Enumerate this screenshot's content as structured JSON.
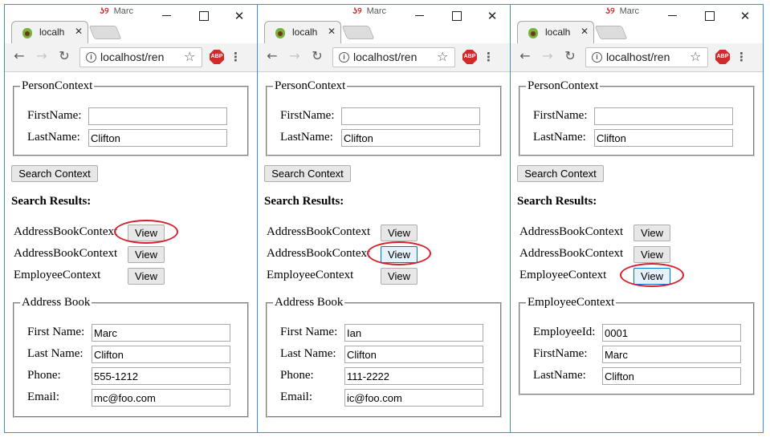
{
  "windows": [
    {
      "profile": "Marc",
      "tab_title": "localh",
      "url": "localhost/ren",
      "person_context": {
        "legend": "PersonContext",
        "first_name_label": "FirstName:",
        "first_name_value": "",
        "last_name_label": "LastName:",
        "last_name_value": "Clifton"
      },
      "search_button": "Search Context",
      "results_heading": "Search Results:",
      "results": [
        {
          "label": "AddressBookContext",
          "button": "View",
          "circled": true
        },
        {
          "label": "AddressBookContext",
          "button": "View",
          "circled": false
        },
        {
          "label": "EmployeeContext",
          "button": "View",
          "circled": false
        }
      ],
      "detail": {
        "legend": "Address Book",
        "fields": [
          {
            "label": "First Name:",
            "value": "Marc"
          },
          {
            "label": "Last Name:",
            "value": "Clifton"
          },
          {
            "label": "Phone:",
            "value": "555-1212"
          },
          {
            "label": "Email:",
            "value": "mc@foo.com"
          }
        ]
      }
    },
    {
      "profile": "Marc",
      "tab_title": "localh",
      "url": "localhost/ren",
      "person_context": {
        "legend": "PersonContext",
        "first_name_label": "FirstName:",
        "first_name_value": "",
        "last_name_label": "LastName:",
        "last_name_value": "Clifton"
      },
      "search_button": "Search Context",
      "results_heading": "Search Results:",
      "results": [
        {
          "label": "AddressBookContext",
          "button": "View",
          "circled": false
        },
        {
          "label": "AddressBookContext",
          "button": "View",
          "circled": true
        },
        {
          "label": "EmployeeContext",
          "button": "View",
          "circled": false
        }
      ],
      "detail": {
        "legend": "Address Book",
        "fields": [
          {
            "label": "First Name:",
            "value": "Ian"
          },
          {
            "label": "Last Name:",
            "value": "Clifton"
          },
          {
            "label": "Phone:",
            "value": "111-2222"
          },
          {
            "label": "Email:",
            "value": "ic@foo.com"
          }
        ]
      }
    },
    {
      "profile": "Marc",
      "tab_title": "localh",
      "url": "localhost/ren",
      "person_context": {
        "legend": "PersonContext",
        "first_name_label": "FirstName:",
        "first_name_value": "",
        "last_name_label": "LastName:",
        "last_name_value": "Clifton"
      },
      "search_button": "Search Context",
      "results_heading": "Search Results:",
      "results": [
        {
          "label": "AddressBookContext",
          "button": "View",
          "circled": false
        },
        {
          "label": "AddressBookContext",
          "button": "View",
          "circled": false
        },
        {
          "label": "EmployeeContext",
          "button": "View",
          "circled": true
        }
      ],
      "detail": {
        "legend": "EmployeeContext",
        "fields": [
          {
            "label": "EmployeeId:",
            "value": "0001"
          },
          {
            "label": "FirstName:",
            "value": "Marc"
          },
          {
            "label": "LastName:",
            "value": "Clifton"
          }
        ]
      }
    }
  ],
  "icons": {
    "profile": "profile-icon",
    "back": "back-arrow-icon",
    "forward": "forward-arrow-icon",
    "reload": "reload-icon",
    "info": "info-icon",
    "bookmark": "star-icon",
    "adblock": "adblock-plus-icon",
    "menu": "kebab-menu-icon",
    "favicon": "avocado-favicon-icon"
  },
  "colors": {
    "highlight_ring": "#d4202f",
    "window_border": "#3c8fd6",
    "adblock": "#d02a2a"
  },
  "adblock_text": "ABP"
}
